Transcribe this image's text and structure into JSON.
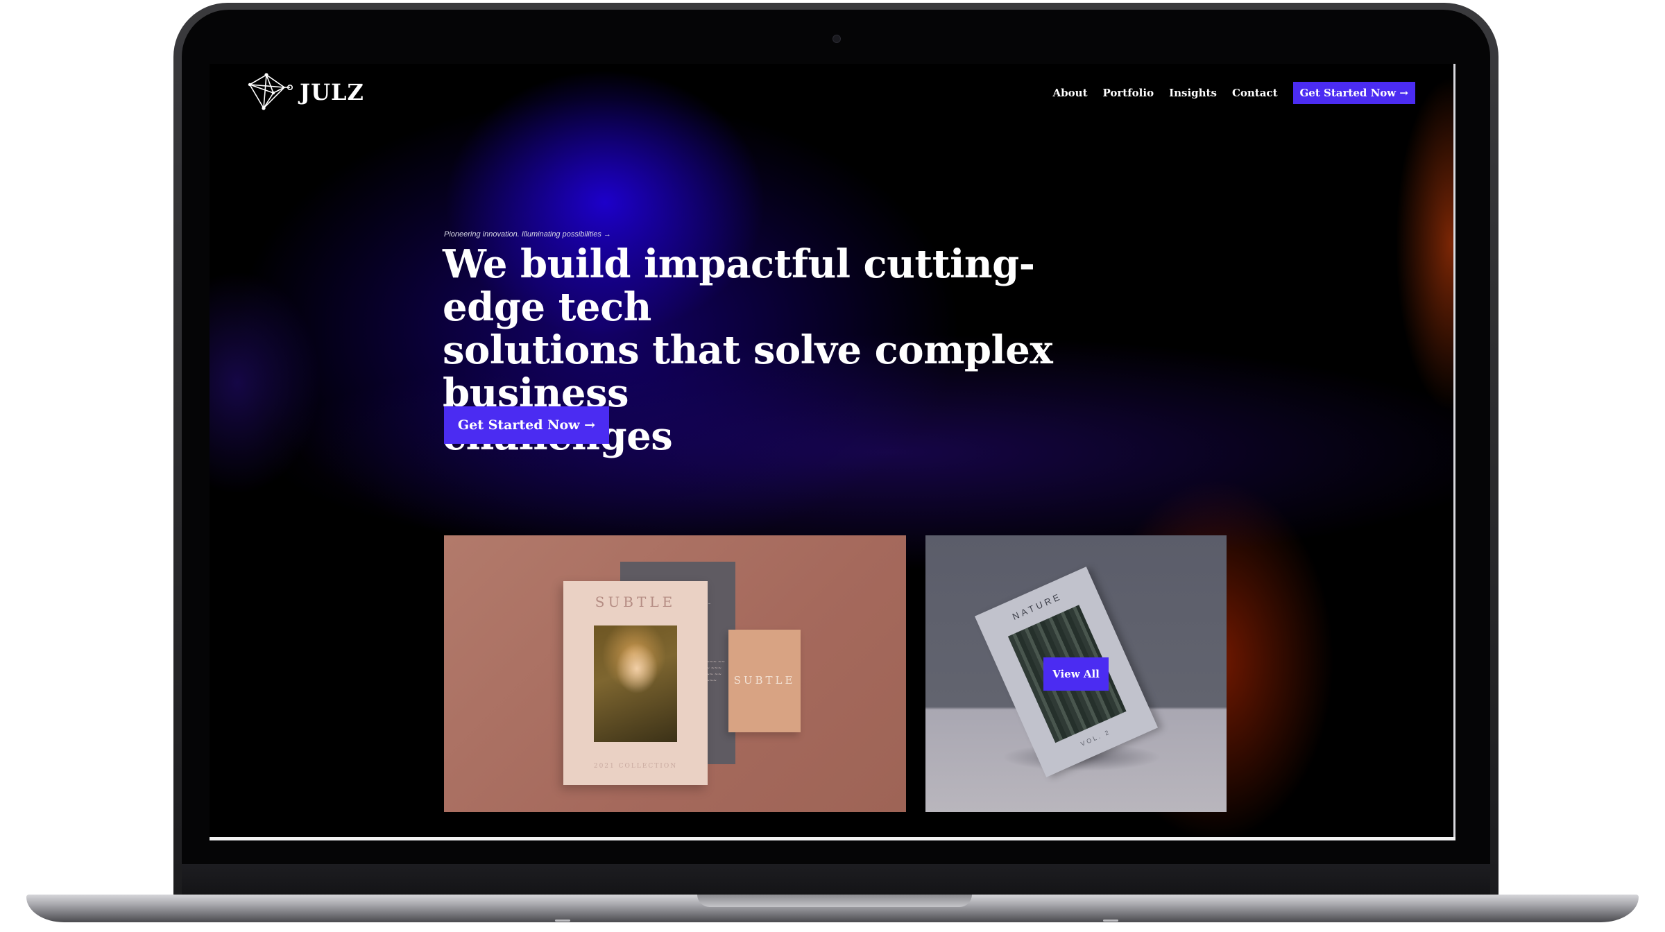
{
  "brand": {
    "name": "JULZ",
    "logo_icon": "network-gem-icon"
  },
  "nav": {
    "links": [
      "About",
      "Portfolio",
      "Insights",
      "Contact"
    ],
    "cta": "Get Started Now →"
  },
  "hero": {
    "tagline": "Pioneering innovation. Illuminating possibilities →",
    "headline_lines": [
      "We build impactful cutting-edge tech",
      "solutions that solve complex business",
      "challenges"
    ],
    "cta": "Get Started Now →"
  },
  "portfolio": {
    "card_subtle": {
      "front_title": "SUBTLE",
      "front_footer": "2021 COLLECTION",
      "side_title": "SUBTLE",
      "back_footer": "SUBTLE"
    },
    "card_nature": {
      "book_title": "NATURE",
      "book_footer": "VOL. 2",
      "button": "View All"
    }
  },
  "colors": {
    "accent": "#4b2cf2",
    "background": "#000000",
    "glow_blue": "#1e00d2",
    "glow_orange": "#d22d00"
  }
}
